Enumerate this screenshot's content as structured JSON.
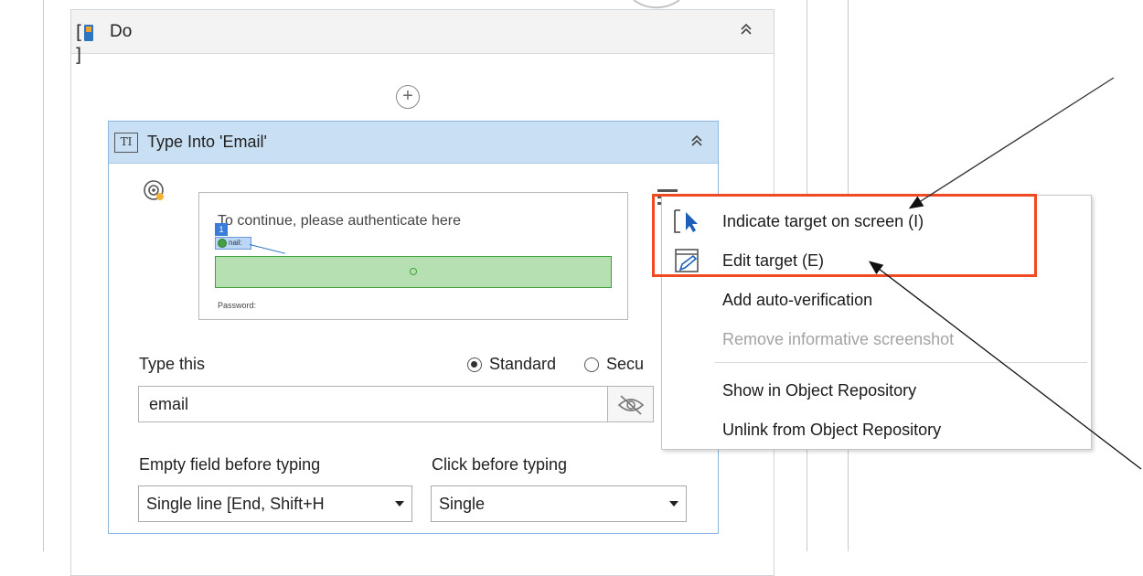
{
  "do_block": {
    "title": "Do",
    "collapse_icon": "double-chevron-up-icon",
    "add_icon": "plus-circle-icon"
  },
  "activity": {
    "title": "Type Into 'Email'",
    "collapse_icon": "double-chevron-up-icon",
    "target_icon": "target-icon",
    "menu_icon": "hamburger-menu-icon",
    "preview": {
      "caption": "To continue, please authenticate here",
      "email_tag": "nail:",
      "password_label": "Password:"
    },
    "type_this_label": "Type this",
    "mode_options": [
      {
        "label": "Standard",
        "selected": true
      },
      {
        "label": "Secu",
        "selected": false
      }
    ],
    "type_this_value": "email",
    "eye_icon": "eye-slash-icon",
    "empty_field_label": "Empty field before typing",
    "empty_field_value": "Single line [End, Shift+H",
    "click_before_label": "Click before typing",
    "click_before_value": "Single"
  },
  "context_menu": {
    "items": [
      {
        "label": "Indicate target on screen (I)",
        "icon": "cursor-indicate-icon",
        "disabled": false
      },
      {
        "label": "Edit target (E)",
        "icon": "edit-pencil-icon",
        "disabled": false
      },
      {
        "label": "Add auto-verification",
        "icon": "",
        "disabled": false
      },
      {
        "label": "Remove informative screenshot",
        "icon": "",
        "disabled": true
      },
      {
        "label": "Show in Object Repository",
        "icon": "",
        "disabled": false
      },
      {
        "label": "Unlink from Object Repository",
        "icon": "",
        "disabled": false
      }
    ]
  },
  "colors": {
    "highlight": "#ef4a24",
    "activity_header": "#c9dff3",
    "target_field": "#b6dfb2"
  }
}
